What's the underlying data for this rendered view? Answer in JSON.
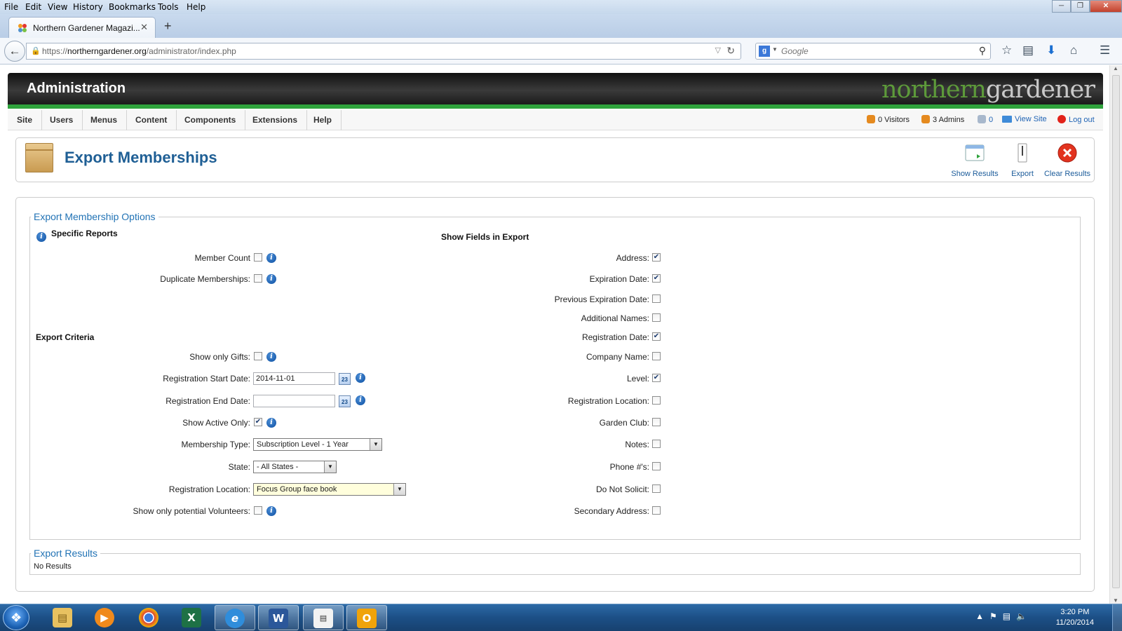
{
  "browser": {
    "menu": [
      "File",
      "Edit",
      "View",
      "History",
      "Bookmarks",
      "Tools",
      "Help"
    ],
    "tab_title": "Northern Gardener Magazi...",
    "new_tab": "+",
    "url_prefix": "https://",
    "url_host": "northerngardener.org",
    "url_path": "/administrator/index.php",
    "search_placeholder": "Google",
    "window_controls": [
      "minimize",
      "restore",
      "close"
    ]
  },
  "admin": {
    "header_title": "Administration",
    "logo_part1": "northern",
    "logo_part2": "gardener",
    "menu": [
      "Site",
      "Users",
      "Menus",
      "Content",
      "Components",
      "Extensions",
      "Help"
    ],
    "status": {
      "visitors": "0 Visitors",
      "admins": "3 Admins",
      "messages": "0",
      "view_site": "View Site",
      "logout": "Log out"
    },
    "page_title": "Export Memberships",
    "toolbar": {
      "show_results": "Show Results",
      "export": "Export",
      "clear_results": "Clear Results"
    }
  },
  "form": {
    "legend": "Export Membership Options",
    "specific_reports_heading": "Specific Reports",
    "member_count": {
      "label": "Member Count",
      "checked": false
    },
    "duplicate_memberships": {
      "label": "Duplicate Memberships:",
      "checked": false
    },
    "export_criteria_heading": "Export Criteria",
    "show_only_gifts": {
      "label": "Show only Gifts:",
      "checked": false
    },
    "registration_start_date": {
      "label": "Registration Start Date:",
      "value": "2014-11-01"
    },
    "registration_end_date": {
      "label": "Registration End Date:",
      "value": ""
    },
    "calendar_glyph": "23",
    "show_active_only": {
      "label": "Show Active Only:",
      "checked": true
    },
    "membership_type": {
      "label": "Membership Type:",
      "value": "Subscription Level - 1 Year"
    },
    "state": {
      "label": "State:",
      "value": "- All States -"
    },
    "registration_location": {
      "label": "Registration Location:",
      "value": "Focus Group face book"
    },
    "potential_volunteers": {
      "label": "Show only potential Volunteers:",
      "checked": false
    },
    "show_fields_heading": "Show Fields in Export",
    "fields": [
      {
        "label": "Address:",
        "checked": true
      },
      {
        "label": "Expiration Date:",
        "checked": true
      },
      {
        "label": "Previous Expiration Date:",
        "checked": false
      },
      {
        "label": "Additional Names:",
        "checked": false
      },
      {
        "label": "Registration Date:",
        "checked": true
      },
      {
        "label": "Company Name:",
        "checked": false
      },
      {
        "label": "Level:",
        "checked": true
      },
      {
        "label": "Registration Location:",
        "checked": false
      },
      {
        "label": "Garden Club:",
        "checked": false
      },
      {
        "label": "Notes:",
        "checked": false
      },
      {
        "label": "Phone #'s:",
        "checked": false
      },
      {
        "label": "Do Not Solicit:",
        "checked": false
      },
      {
        "label": "Secondary Address:",
        "checked": false
      }
    ]
  },
  "results": {
    "legend": "Export Results",
    "text": "No Results"
  },
  "taskbar": {
    "apps": [
      "file-explorer",
      "media-player",
      "chrome",
      "excel",
      "internet-explorer",
      "word",
      "notepad",
      "outlook"
    ],
    "time": "3:20 PM",
    "date": "11/20/2014"
  },
  "colors": {
    "accent_blue": "#1f5f95",
    "admin_green": "#2fa33c",
    "taskbar": "#1c4f86"
  }
}
